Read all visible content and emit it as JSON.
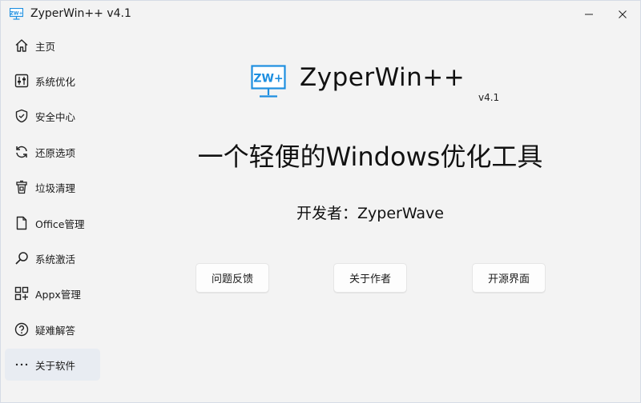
{
  "window": {
    "title": "ZyperWin++ v4.1",
    "logo_text": "ZW+"
  },
  "sidebar": {
    "items": [
      {
        "label": "主页",
        "icon": "home-icon"
      },
      {
        "label": "系统优化",
        "icon": "sliders-icon"
      },
      {
        "label": "安全中心",
        "icon": "shield-icon"
      },
      {
        "label": "还原选项",
        "icon": "refresh-icon"
      },
      {
        "label": "垃圾清理",
        "icon": "trash-icon"
      },
      {
        "label": "Office管理",
        "icon": "document-icon"
      },
      {
        "label": "系统激活",
        "icon": "key-icon"
      },
      {
        "label": "Appx管理",
        "icon": "grid-icon"
      },
      {
        "label": "疑难解答",
        "icon": "help-icon"
      },
      {
        "label": "关于软件",
        "icon": "more-icon"
      }
    ],
    "active_index": 9
  },
  "main": {
    "app_name": "ZyperWin++",
    "version": "v4.1",
    "tagline": "一个轻便的Windows优化工具",
    "developer": "开发者：ZyperWave",
    "buttons": {
      "feedback": "问题反馈",
      "author": "关于作者",
      "source": "开源界面"
    }
  },
  "colors": {
    "accent": "#1e8fe0",
    "background": "#f3f3f3",
    "active_item": "#e8ecf2"
  }
}
